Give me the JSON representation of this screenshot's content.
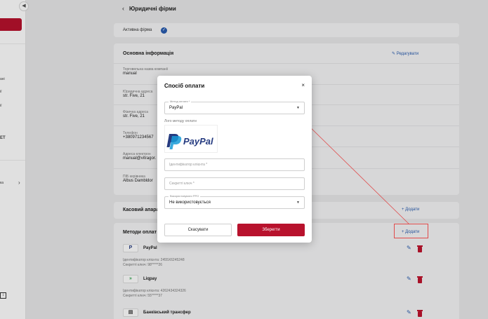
{
  "sidebar": {
    "fragments": [
      "ані",
      "ії",
      "ії",
      "ET",
      "ка"
    ],
    "chevron": "›",
    "collapse_glyph": "◀",
    "scroll_glyph": "↕"
  },
  "page": {
    "breadcrumb": "Юридичні фірми",
    "back_glyph": "‹",
    "active_firm_label": "Активна фірма",
    "main_info": {
      "title": "Основна інформація",
      "edit_label": "Редагувати",
      "rows": [
        {
          "label": "Торговельна назва компанії",
          "value": "manual"
        },
        {
          "label": "Юридична адреса",
          "value": "str. Five, 21"
        },
        {
          "label": "Фізична адреса",
          "value": "str. Five, 21"
        },
        {
          "label": "Телефон",
          "value": "+380971234567"
        },
        {
          "label": "Адреса електрон",
          "value": "manual@vitragor."
        },
        {
          "label": "ПІБ керівника",
          "value": "Albus Dambldor"
        }
      ]
    },
    "cash_register": {
      "title": "Касовий апара",
      "add_label": "+ Додати"
    },
    "payment_methods": {
      "title": "Методи оплат",
      "add_label": "+ Додати",
      "items": [
        {
          "name": "PayPal",
          "logo": "P",
          "line1": "Ідентифікатор клієнта: 2455X6245248",
          "line2": "Секретті ключ: 98*****26"
        },
        {
          "name": "Liqpay",
          "logo": "»",
          "line1": "Ідентифікатор клієнта: 4262434324326",
          "line2": "Секретті ключ: 55*****37"
        },
        {
          "name": "Банківський трансфер",
          "logo": "▤",
          "line1": "",
          "line2": ""
        }
      ]
    }
  },
  "modal": {
    "title": "Спосіб оплати",
    "close_glyph": "×",
    "method": {
      "label": "Метод оплати *",
      "value": "PayPal"
    },
    "logo_label": "Лого методу оплати",
    "logo_text": "PayPal",
    "client_id_placeholder": "Ідентифікатор клієнта *",
    "secret_placeholder": "Секретті ключ *",
    "rro": {
      "label": "Використовувати РРО",
      "value": "Не використовується"
    },
    "cancel_label": "Скасувати",
    "save_label": "Зберегти"
  },
  "colors": {
    "accent": "#b8122d",
    "link": "#2a5db0",
    "highlight": "#e04b4b"
  }
}
